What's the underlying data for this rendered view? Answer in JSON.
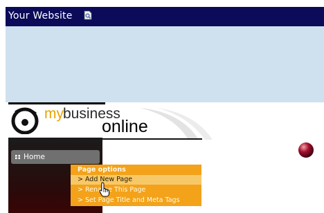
{
  "window": {
    "title": "Your Website"
  },
  "logo": {
    "part1": "my",
    "part2": "business",
    "part3": "online"
  },
  "sidebar": {
    "home_label": "Home"
  },
  "menu": {
    "title": "Page options",
    "items": [
      {
        "label": "> Add New Page"
      },
      {
        "label": "> Rename This Page"
      },
      {
        "label": "> Set Page Title and Meta Tags"
      }
    ]
  },
  "colors": {
    "top_bar": "#0b0b5a",
    "header_band": "#cfe0ee",
    "menu_bg": "#f3a21a",
    "menu_hover": "#f7c867",
    "logo_accent": "#e7a300"
  },
  "icons": [
    "page-search-icon",
    "grip-icon",
    "pointer-hand-cursor-icon"
  ]
}
